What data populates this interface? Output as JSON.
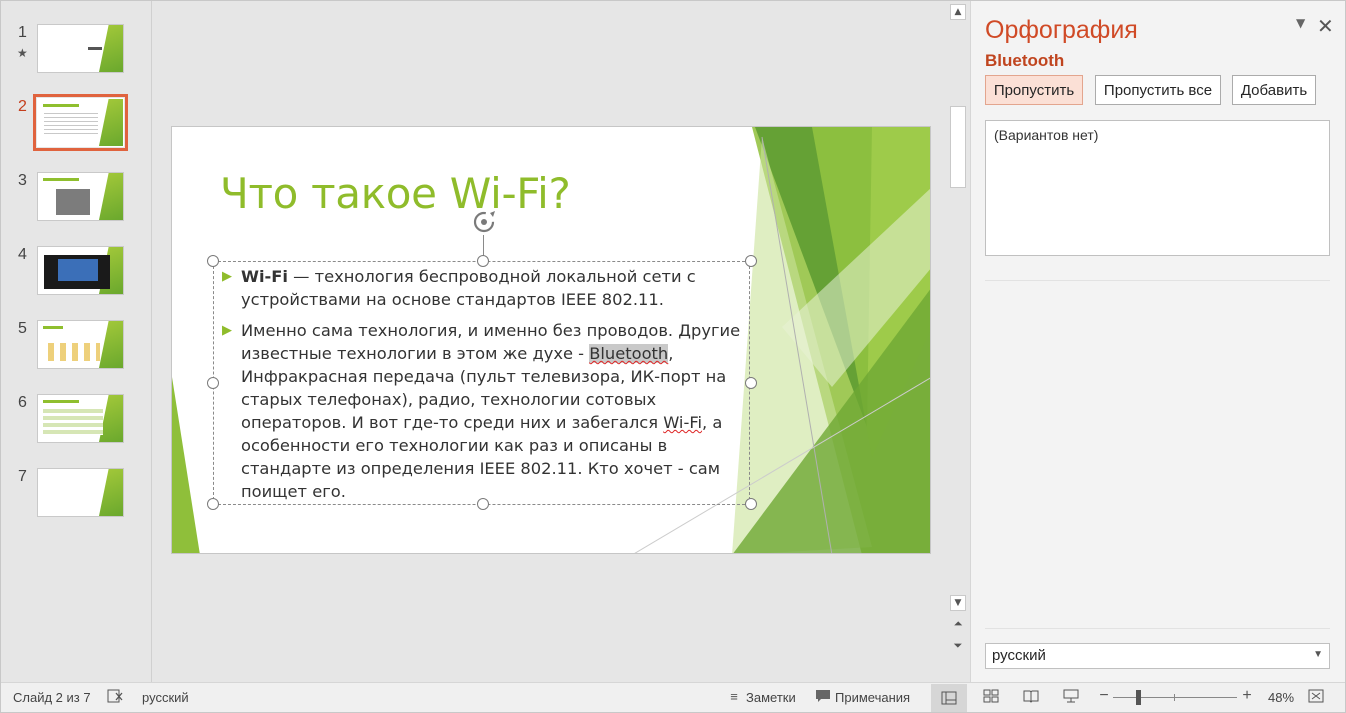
{
  "thumbnails": [
    {
      "number": "1",
      "star": "★"
    },
    {
      "number": "2"
    },
    {
      "number": "3"
    },
    {
      "number": "4"
    },
    {
      "number": "5"
    },
    {
      "number": "6"
    },
    {
      "number": "7"
    }
  ],
  "slide": {
    "title": "Что такое Wi-Fi?",
    "bullet1": {
      "bold": "Wi-Fi",
      "text": " — технология беспроводной локальной сети с устройствами на основе стандартов IEEE 802.11."
    },
    "bullet2": {
      "text_a": "Именно сама технология, и именно без проводов. Другие известные технологии в этом же духе - ",
      "misspelled": "Bluetooth",
      "text_b": ", Инфракрасная передача (пульт телевизора, ИК-порт на старых телефонах), радио, технологии сотовых операторов. И вот где-то среди них и забегался ",
      "wifi": "Wi-Fi",
      "text_c": ", а особенности его технологии как раз и описаны в стандарте из определения IEEE 802.11. Кто хочет - сам поищет его."
    }
  },
  "spelling_pane": {
    "title": "Орфография",
    "word": "Bluetooth",
    "skip_label": "Пропустить",
    "skip_all_label": "Пропустить все",
    "add_label": "Добавить",
    "suggestions_empty": "(Вариантов нет)",
    "language": "русский"
  },
  "status_bar": {
    "slide_info": "Слайд 2 из 7",
    "language": "русский",
    "notes_label": "Заметки",
    "comments_label": "Примечания",
    "zoom": "48%"
  },
  "colors": {
    "accent": "#d04a26",
    "title_green": "#8fbc2b"
  }
}
